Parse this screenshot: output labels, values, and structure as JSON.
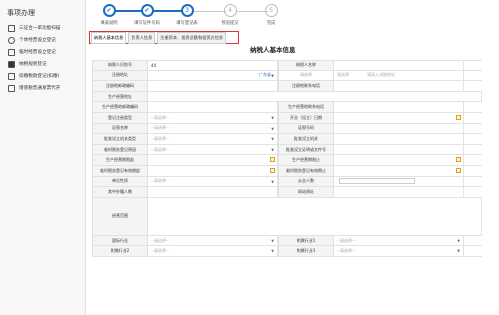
{
  "sidebar": {
    "title": "事项办理",
    "items": [
      {
        "label": "三证合一单功能扫描"
      },
      {
        "label": "个体经营设立登记"
      },
      {
        "label": "临时经营设立登记"
      },
      {
        "label": "纳税规则登记"
      },
      {
        "label": "扣缴税款登记(扣缴)"
      },
      {
        "label": "增值税普通发票代开"
      }
    ]
  },
  "steps": [
    {
      "label": "填表说明",
      "state": "done",
      "symbol": "✔"
    },
    {
      "label": "填写证件号码",
      "state": "done",
      "symbol": "✔"
    },
    {
      "label": "填写登记表",
      "state": "current",
      "symbol": "3"
    },
    {
      "label": "预览提交",
      "state": "todo",
      "symbol": "4"
    },
    {
      "label": "完成",
      "state": "todo",
      "symbol": "5"
    }
  ],
  "tabs": [
    "纳税人基本信息",
    "负责人信息",
    "注册资本、投资总额和投资方信息"
  ],
  "form_title": "纳税人基本信息",
  "form": {
    "r1": {
      "l1": "纳税人识别号",
      "v1": "44",
      "l2": "纳税人名称",
      "v2": ""
    },
    "r2": {
      "l1": "注册地址",
      "v1": "广东省",
      "v1b": "请选择",
      "l2": "",
      "v2": "请选择",
      "v2b": "请录入详细地址"
    },
    "r3": {
      "l1": "注册地邮政编码",
      "v1": "",
      "l2": "注册地联系电话",
      "v2": ""
    },
    "r4": {
      "l1": "生产经营地址",
      "v1": ""
    },
    "r5": {
      "l1": "生产经营地邮政编码",
      "v1": "",
      "l2": "生产经营地联系电话",
      "v2": ""
    },
    "r6": {
      "l1": "登记注册类型",
      "v1": "--请选择--",
      "l2": "开业（设立）日期",
      "v2": ""
    },
    "r7": {
      "l1": "证照名称",
      "v1": "--请选择--",
      "l2": "证照号码",
      "v2": ""
    },
    "r8": {
      "l1": "批准设立机关类型",
      "v1": "--请选择--",
      "l2": "批准设立机关",
      "v2": ""
    },
    "r9": {
      "l1": "临时税务登记原因",
      "v1": "--请选择--",
      "l2": "批准设立证明或文件号",
      "v2": ""
    },
    "r10": {
      "l1": "生产经营期限起",
      "v1": "",
      "l2": "生产经营期限止",
      "v2": ""
    },
    "r11": {
      "l1": "临时税务登记有效期起",
      "v1": "",
      "l2": "临时税务登记有效期止",
      "v2": ""
    },
    "r12": {
      "l1": "单位性质",
      "v1": "--请选择--",
      "l2": "从业人数",
      "v2": ""
    },
    "r13": {
      "l1": "其中外籍人数",
      "v1": "",
      "l2": "网站网址",
      "v2": ""
    },
    "r14": {
      "l1": "经营范围",
      "v1": ""
    },
    "r15": {
      "l1": "国标行业",
      "v1": "--请选择--",
      "l2": "附属行业1",
      "v2": "--请选择--"
    },
    "r16": {
      "l1": "附属行业2",
      "v1": "--请选择--",
      "l2": "附属行业3",
      "v2": "--请选择--"
    }
  }
}
